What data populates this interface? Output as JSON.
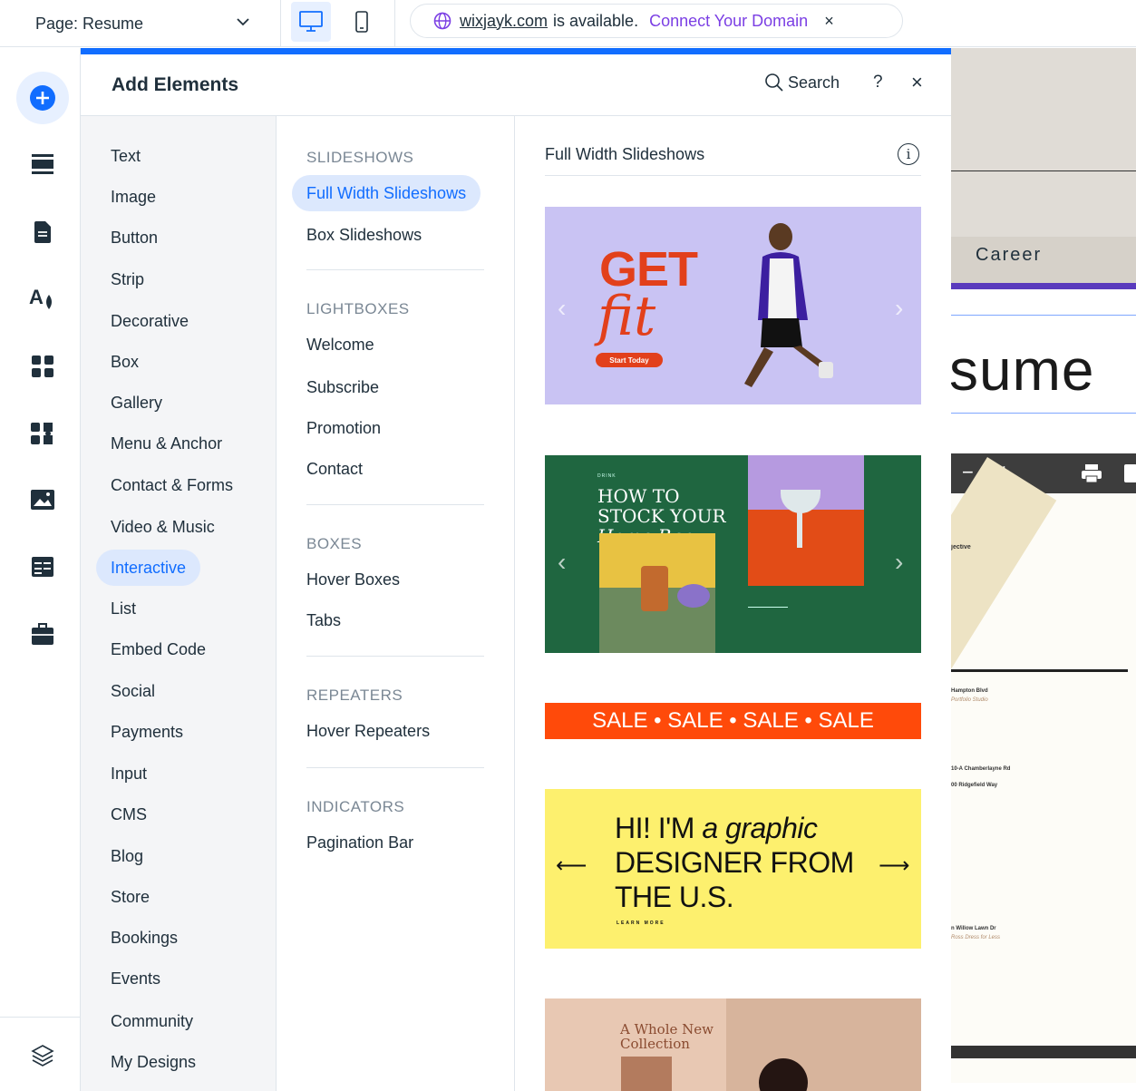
{
  "topbar": {
    "page_label": "Page: Resume",
    "domain_name": "wixjayk.com",
    "domain_available": "is available.",
    "connect_label": "Connect Your Domain",
    "close_symbol": "×"
  },
  "panel": {
    "title": "Add Elements",
    "search_label": "Search",
    "help_symbol": "?",
    "close_symbol": "×"
  },
  "categories": [
    "Text",
    "Image",
    "Button",
    "Strip",
    "Decorative",
    "Box",
    "Gallery",
    "Menu & Anchor",
    "Contact & Forms",
    "Video & Music",
    "Interactive",
    "List",
    "Embed Code",
    "Social",
    "Payments",
    "Input",
    "CMS",
    "Blog",
    "Store",
    "Bookings",
    "Events",
    "Community",
    "My Designs"
  ],
  "active_category": "Interactive",
  "sections": {
    "slideshows": {
      "heading": "SLIDESHOWS",
      "items": [
        "Full Width Slideshows",
        "Box Slideshows"
      ]
    },
    "lightboxes": {
      "heading": "LIGHTBOXES",
      "items": [
        "Welcome",
        "Subscribe",
        "Promotion",
        "Contact"
      ]
    },
    "boxes": {
      "heading": "BOXES",
      "items": [
        "Hover Boxes",
        "Tabs"
      ]
    },
    "repeaters": {
      "heading": "REPEATERS",
      "items": [
        "Hover Repeaters"
      ]
    },
    "indicators": {
      "heading": "INDICATORS",
      "items": [
        "Pagination Bar"
      ]
    }
  },
  "active_subcategory": "Full Width Slideshows",
  "preview": {
    "title": "Full Width Slideshows",
    "info_symbol": "i",
    "thumb1": {
      "line1": "GET",
      "line2": "fit",
      "button": "Start Today"
    },
    "thumb2": {
      "kicker": "DRINK",
      "line1": "HOW TO",
      "line2": "STOCK YOUR",
      "line3": "Home Bar"
    },
    "thumb3": {
      "text": "SALE • SALE • SALE • SALE"
    },
    "thumb4": {
      "line1a": "HI! I'M ",
      "line1b": "a graphic",
      "line2": "DESIGNER FROM",
      "line3": "THE U.S.",
      "cta": "LEARN MORE",
      "left_arrow": "⟵",
      "right_arrow": "⟶"
    },
    "thumb5": {
      "line1": "A Whole New",
      "line2": "Collection"
    },
    "colors": {
      "accent": "#116dff",
      "thumb1_bg": "#c9c3f3",
      "thumb2_bg": "#1f6640",
      "thumb3_bg": "#ff4a0a",
      "thumb4_bg": "#fdf06e"
    }
  },
  "canvas": {
    "career": "Career",
    "resume_fragment": "sume",
    "objective_heading": "jective",
    "address1": "Hampton Blvd",
    "studio": "Portfolio Studio",
    "address2": "10-A Chamberlayne Rd",
    "address3": "00 Ridgefield Way",
    "address4": "n Willow Lawn Dr",
    "store": "Ross Dress for Less"
  },
  "colors": {
    "brand": "#116dff",
    "connect": "#7b3fe4",
    "active_bg": "#dce8fd"
  }
}
